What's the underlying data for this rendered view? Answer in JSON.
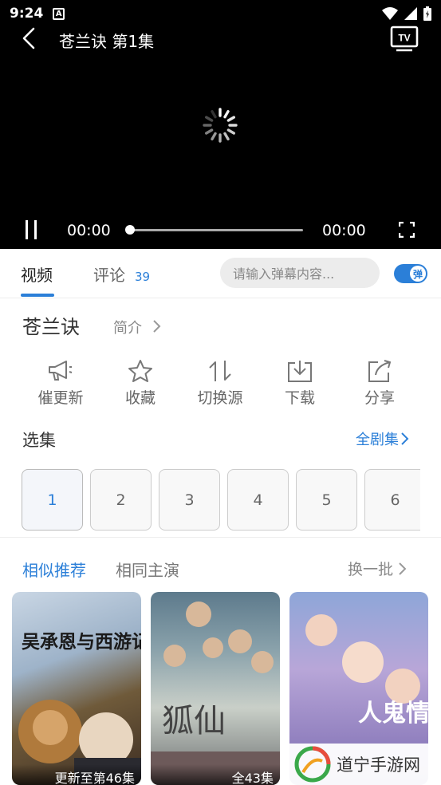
{
  "status_bar": {
    "time": "9:24",
    "a_badge": "A"
  },
  "player": {
    "title": "苍兰诀 第1集",
    "current_time": "00:00",
    "duration": "00:00",
    "progress": 0,
    "tv_label": "TV"
  },
  "tabs": {
    "video": "视频",
    "comment": "评论",
    "comment_count": "39",
    "danmu_placeholder": "请输入弹幕内容...",
    "danmu_toggle_label": "弹"
  },
  "show": {
    "title": "苍兰诀",
    "intro": "简介"
  },
  "actions": [
    {
      "label": "催更新",
      "icon": "megaphone-icon"
    },
    {
      "label": "收藏",
      "icon": "star-icon"
    },
    {
      "label": "切换源",
      "icon": "switch-icon"
    },
    {
      "label": "下载",
      "icon": "download-icon"
    },
    {
      "label": "分享",
      "icon": "share-icon"
    }
  ],
  "episodes": {
    "heading": "选集",
    "all_label": "全剧集",
    "items": [
      "1",
      "2",
      "3",
      "4",
      "5",
      "6"
    ]
  },
  "recommend": {
    "tab_similar": "相似推荐",
    "tab_same_cast": "相同主演",
    "refresh": "换一批",
    "posters": [
      {
        "title_art": "吴承恩与西游记",
        "caption": "更新至第46集"
      },
      {
        "title_art": "狐仙",
        "caption": "全43集"
      },
      {
        "title_art": "人鬼情",
        "caption": ""
      }
    ]
  },
  "watermark": {
    "text": "道宁手游网"
  },
  "colors": {
    "accent": "#2b7fd8",
    "player_bg": "#000000"
  }
}
